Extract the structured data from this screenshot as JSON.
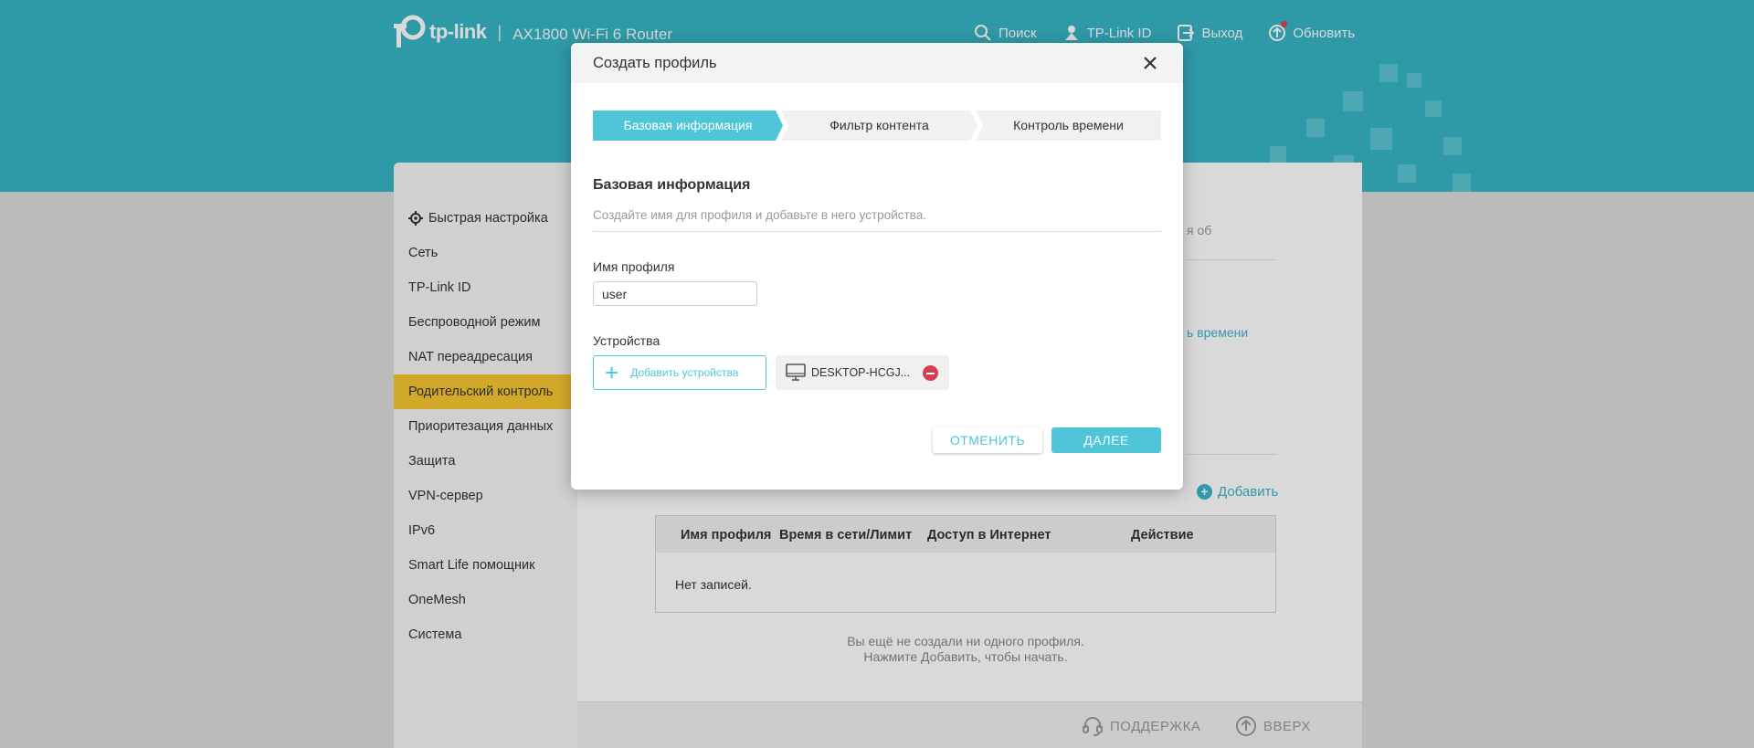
{
  "header": {
    "brand": "tp-link",
    "separator": "|",
    "model": "AX1800 Wi-Fi 6 Router",
    "nav": {
      "search": "Поиск",
      "tplink_id": "TP-Link ID",
      "logout": "Выход",
      "update": "Обновить"
    }
  },
  "sidebar": {
    "items": [
      {
        "label": "Быстрая настройка",
        "icon": "gear-icon"
      },
      {
        "label": "Сеть"
      },
      {
        "label": "TP-Link ID"
      },
      {
        "label": "Беспроводной режим"
      },
      {
        "label": "NAT переадресация"
      },
      {
        "label": "Родительский контроль",
        "active": true
      },
      {
        "label": "Приоритезация данных"
      },
      {
        "label": "Защита"
      },
      {
        "label": "VPN-сервер"
      },
      {
        "label": "IPv6"
      },
      {
        "label": "Smart Life помощник"
      },
      {
        "label": "OneMesh"
      },
      {
        "label": "Система"
      }
    ]
  },
  "background_page": {
    "partial_text": "я об",
    "partial_link": "ь времени",
    "add_label": "Добавить",
    "table": {
      "columns": [
        "Имя профиля",
        "Время в сети/Лимит",
        "Доступ в Интернет",
        "Действие"
      ],
      "empty": "Нет записей."
    },
    "empty_message": {
      "line1": "Вы ещё не создали ни одного профиля.",
      "line2": "Нажмите Добавить, чтобы начать."
    },
    "footer": {
      "support": "ПОДДЕРЖКА",
      "top": "ВВЕРХ"
    }
  },
  "modal": {
    "title": "Создать профиль",
    "steps": [
      "Базовая информация",
      "Фильтр контента",
      "Контроль времени"
    ],
    "active_step": 0,
    "section_title": "Базовая информация",
    "section_subtitle": "Создайте имя для профиля и добавьте в него устройства.",
    "profile_name_label": "Имя профиля",
    "profile_name_value": "user",
    "devices_label": "Устройства",
    "add_devices_label": "Добавить устройства",
    "devices": [
      {
        "name": "DESKTOP-HCGJ...",
        "icon": "monitor-icon"
      }
    ],
    "cancel_label": "ОТМЕНИТЬ",
    "next_label": "ДАЛЕЕ"
  },
  "colors": {
    "header_bg": "#37b4c5",
    "accent": "#4ec6d8",
    "active_nav": "#f7c62f",
    "remove": "#d43f58"
  }
}
